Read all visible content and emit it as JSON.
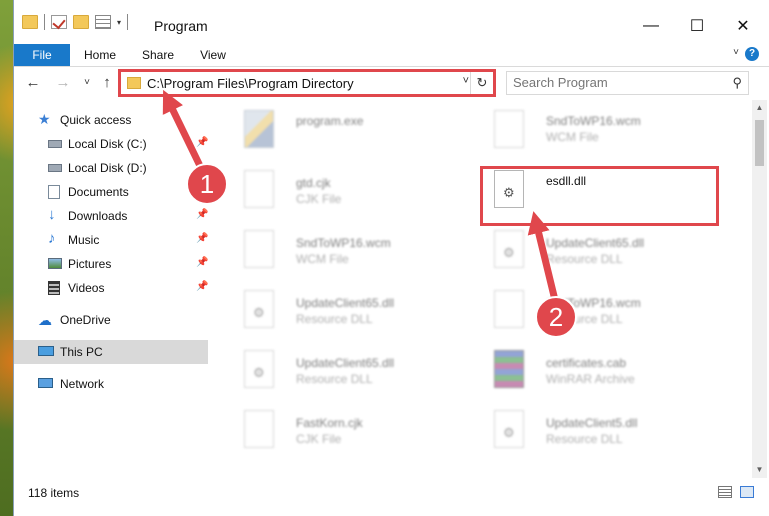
{
  "window": {
    "title": "Program",
    "minimize_glyph": "—",
    "maximize_glyph": "☐",
    "close_glyph": "✕"
  },
  "ribbon": {
    "tabs": [
      {
        "label": "File"
      },
      {
        "label": "Home"
      },
      {
        "label": "Share"
      },
      {
        "label": "View"
      }
    ],
    "help_glyph": "?"
  },
  "nav": {
    "back_glyph": "←",
    "forward_glyph": "→",
    "recent_glyph": "˅",
    "up_glyph": "↑"
  },
  "address": {
    "path": "C:\\Program Files\\Program Directory",
    "refresh_glyph": "↻",
    "dropdown_glyph": "˅"
  },
  "search": {
    "placeholder": "Search Program",
    "icon_glyph": "⚲"
  },
  "sidebar": {
    "items": [
      {
        "label": "Quick access",
        "icon": "star-icon",
        "pinned": false
      },
      {
        "label": "Local Disk (C:)",
        "icon": "drive-icon",
        "pinned": true
      },
      {
        "label": "Local Disk (D:)",
        "icon": "drive-icon",
        "pinned": false
      },
      {
        "label": "Documents",
        "icon": "documents-icon",
        "pinned": true
      },
      {
        "label": "Downloads",
        "icon": "download-arrow-icon",
        "pinned": true
      },
      {
        "label": "Music",
        "icon": "music-note-icon",
        "pinned": true
      },
      {
        "label": "Pictures",
        "icon": "pictures-icon",
        "pinned": true
      },
      {
        "label": "Videos",
        "icon": "film-icon",
        "pinned": true
      },
      {
        "label": "OneDrive",
        "icon": "cloud-icon",
        "pinned": false
      },
      {
        "label": "This PC",
        "icon": "monitor-icon",
        "pinned": false,
        "selected": true
      },
      {
        "label": "Network",
        "icon": "network-icon",
        "pinned": false
      }
    ],
    "pin_glyph": "📌"
  },
  "files": [
    {
      "name": "program.exe",
      "type": "",
      "icon": "exe-icon",
      "highlighted": false
    },
    {
      "name": "SndToWP16.wcm",
      "type": "WCM File",
      "icon": "document-icon",
      "highlighted": false
    },
    {
      "name": "gtd.cjk",
      "type": "CJK File",
      "icon": "document-icon",
      "highlighted": false
    },
    {
      "name": "esdll.dll",
      "type": "",
      "icon": "gear-document-icon",
      "highlighted": true
    },
    {
      "name": "SndToWP16.wcm",
      "type": "WCM File",
      "icon": "document-icon",
      "highlighted": false
    },
    {
      "name": "UpdateClient65.dll",
      "type": "Resource DLL",
      "icon": "gear-document-icon",
      "highlighted": false
    },
    {
      "name": "UpdateClient65.dll",
      "type": "Resource DLL",
      "icon": "gear-document-icon",
      "highlighted": false
    },
    {
      "name": "SndToWP16.wcm",
      "type": "Resource DLL",
      "icon": "document-icon",
      "highlighted": false
    },
    {
      "name": "UpdateClient65.dll",
      "type": "Resource DLL",
      "icon": "gear-document-icon",
      "highlighted": false
    },
    {
      "name": "certificates.cab",
      "type": "WinRAR Archive",
      "icon": "winrar-icon",
      "highlighted": false
    },
    {
      "name": "FastKorn.cjk",
      "type": "CJK File",
      "icon": "document-icon",
      "highlighted": false
    },
    {
      "name": "UpdateClient5.dll",
      "type": "Resource DLL",
      "icon": "gear-document-icon",
      "highlighted": false
    }
  ],
  "status": {
    "item_count": "118 items"
  },
  "annotations": [
    {
      "label": "1"
    },
    {
      "label": "2"
    }
  ],
  "colors": {
    "accent": "#1979ca",
    "annotation": "#e0474c",
    "selection": "#d9d9d9"
  }
}
